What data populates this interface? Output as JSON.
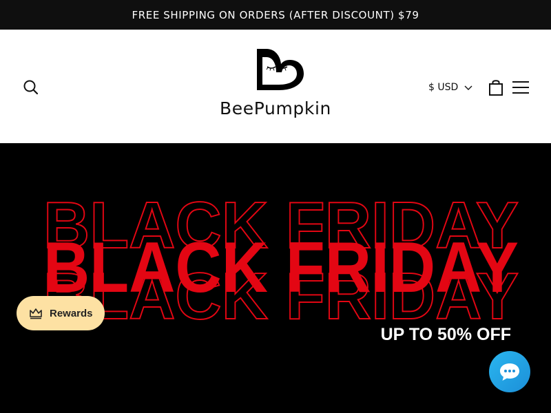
{
  "announcement": {
    "text": "FREE SHIPPING ON ORDERS (AFTER DISCOUNT) $79"
  },
  "header": {
    "brand": "BeePumpkin",
    "currency": "$ USD",
    "icons": {
      "search": "search-icon",
      "currency_dropdown": "chevron-down-icon",
      "cart": "shopping-bag-icon",
      "menu": "hamburger-menu-icon"
    }
  },
  "hero": {
    "headline": "BLACK FRIDAY",
    "subheadline": "UP TO 50% OFF",
    "colors": {
      "background": "#000000",
      "headline": "#e30613",
      "subheadline": "#ffffff"
    }
  },
  "widgets": {
    "rewards": {
      "label": "Rewards",
      "icon": "crown-icon",
      "color": "#fde1a3"
    },
    "chat": {
      "icon": "chat-bubble-icon",
      "color": "#1ea6e8"
    }
  }
}
